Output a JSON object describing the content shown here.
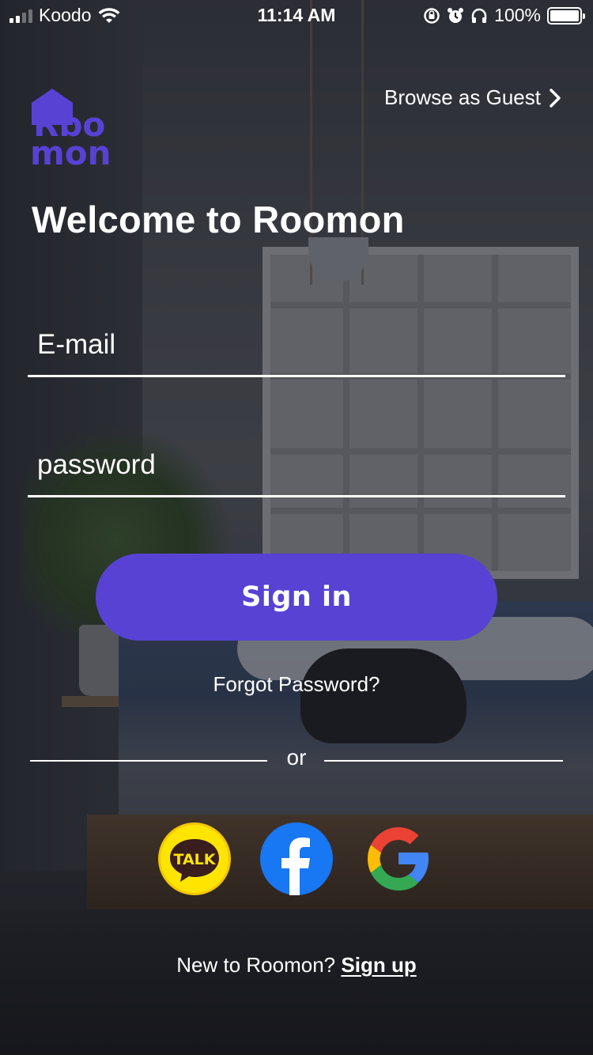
{
  "status_bar": {
    "carrier": "Koodo",
    "time": "11:14 AM",
    "battery": "100%",
    "icons": [
      "signal-icon",
      "wifi-icon",
      "rotation-lock-icon",
      "alarm-icon",
      "headphones-icon",
      "battery-icon"
    ]
  },
  "header": {
    "logo_line1": "Rbo",
    "logo_line2": "mon",
    "browse_guest": "Browse as Guest",
    "title": "Welcome to Roomon"
  },
  "form": {
    "email_placeholder": "E-mail",
    "password_placeholder": "password",
    "sign_in": "Sign in",
    "forgot": "Forgot Password?"
  },
  "divider_text": "or",
  "social": {
    "kakao_label": "TALK",
    "icons": [
      "kakao-talk-icon",
      "facebook-icon",
      "google-icon"
    ]
  },
  "footer": {
    "prompt": "New to Roomon?",
    "link": "Sign up"
  },
  "colors": {
    "brand": "#5742d4",
    "kakao": "#fee500",
    "facebook": "#1877f2"
  }
}
